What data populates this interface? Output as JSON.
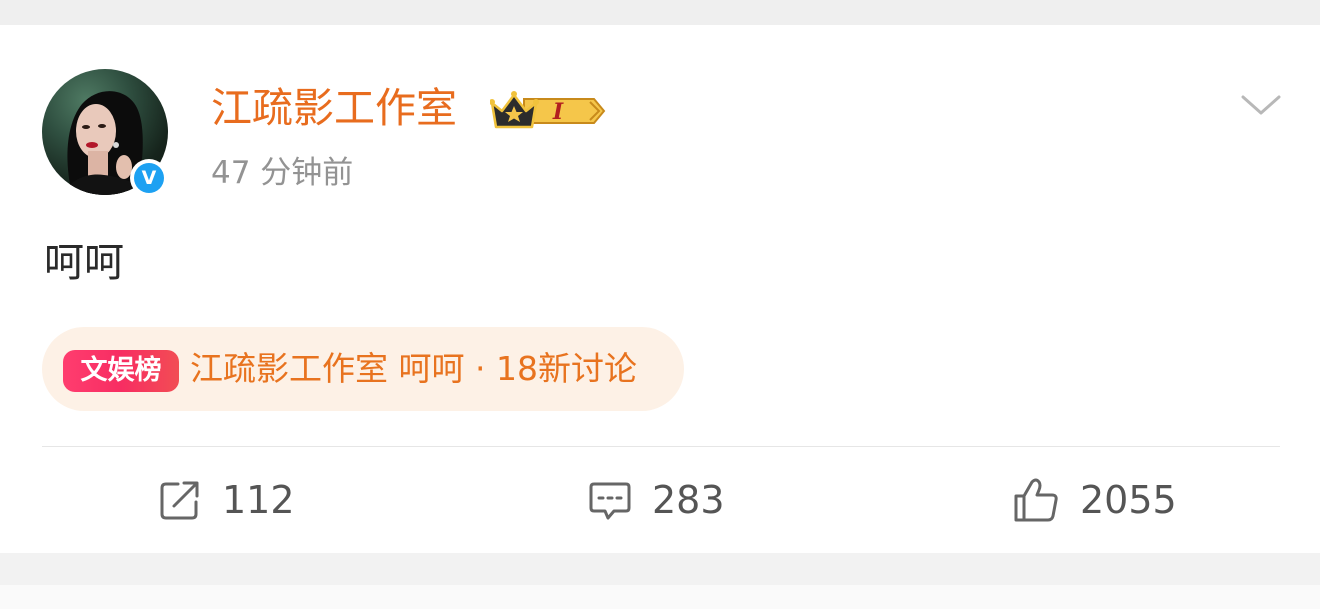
{
  "post": {
    "author": "江疏影工作室",
    "timestamp": "47 分钟前",
    "text": "呵呵",
    "vip_badge_text": "I",
    "verified_mark": "V"
  },
  "topic": {
    "badge_label": "文娱榜",
    "text": "江疏影工作室 呵呵 · 18新讨论"
  },
  "actions": {
    "repost_count": "112",
    "comment_count": "283",
    "like_count": "2055"
  },
  "colors": {
    "author": "#e86c1e",
    "topic_text": "#e8731f",
    "topic_bg": "#fdf1e6",
    "badge_gradient_start": "#ff3d6f",
    "verified_blue": "#1da1f2"
  },
  "icons": {
    "repost": "share-square-icon",
    "comment": "comment-bubble-icon",
    "like": "thumbs-up-icon",
    "more": "chevron-down-icon"
  }
}
